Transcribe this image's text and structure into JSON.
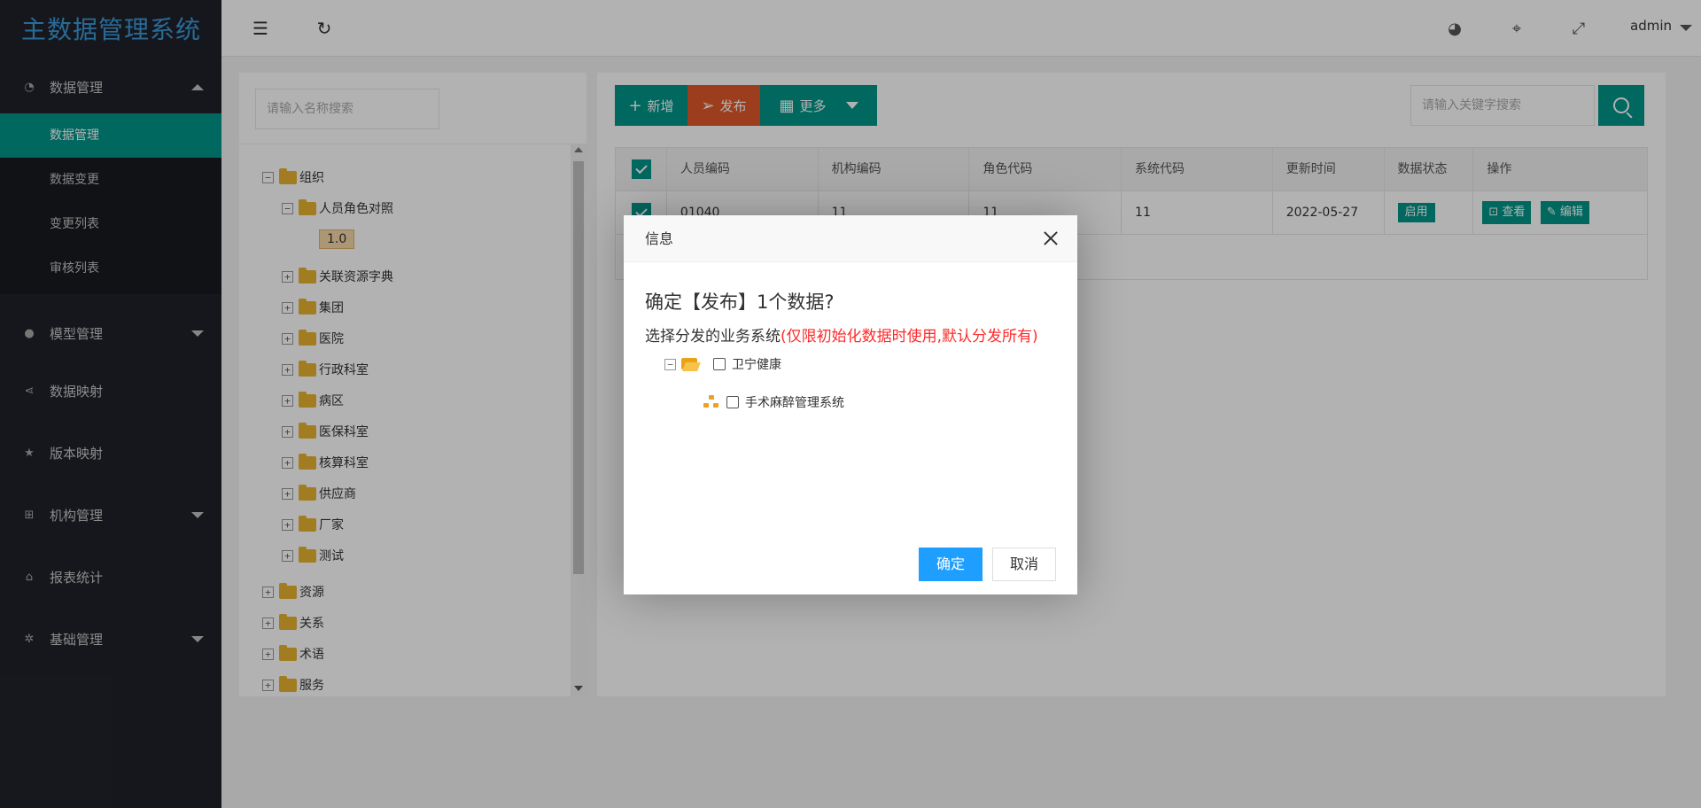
{
  "app": {
    "title": "主数据管理系统"
  },
  "sidebar": {
    "groups": [
      {
        "label": "数据管理",
        "icon": "dashboard-icon",
        "expanded": true,
        "items": [
          {
            "label": "数据管理",
            "active": true
          },
          {
            "label": "数据变更"
          },
          {
            "label": "变更列表"
          },
          {
            "label": "审核列表"
          }
        ]
      },
      {
        "label": "模型管理",
        "icon": "circle-icon",
        "expanded": false
      },
      {
        "label": "数据映射",
        "icon": "share-icon"
      },
      {
        "label": "版本映射",
        "icon": "star-icon"
      },
      {
        "label": "机构管理",
        "icon": "org-icon",
        "expanded": false
      },
      {
        "label": "报表统计",
        "icon": "home-icon"
      },
      {
        "label": "基础管理",
        "icon": "gear-icon",
        "expanded": false
      }
    ]
  },
  "topbar": {
    "icons": [
      "menu-fold-icon",
      "refresh-icon",
      "palette-icon",
      "tag-icon",
      "fullscreen-icon"
    ],
    "user": "admin"
  },
  "tree": {
    "search_placeholder": "请输入名称搜索",
    "nodes": {
      "org": "组织",
      "role_map": "人员角色对照",
      "version": "1.0",
      "res_dict": "关联资源字典",
      "group": "集团",
      "hospital": "医院",
      "admin_dept": "行政科室",
      "ward": "病区",
      "insurance_dept": "医保科室",
      "accounting_dept": "核算科室",
      "supplier": "供应商",
      "factory": "厂家",
      "test": "测试",
      "resource": "资源",
      "relation": "关系",
      "term": "术语",
      "service": "服务"
    }
  },
  "toolbar": {
    "add_label": "新增",
    "publish_label": "发布",
    "more_label": "更多",
    "search_placeholder": "请输入关键字搜索"
  },
  "grid": {
    "columns": [
      "人员编码",
      "机构编码",
      "角色代码",
      "系统代码",
      "更新时间",
      "数据状态",
      "操作"
    ],
    "rows": [
      {
        "person_code": "01040",
        "org_code": "11",
        "role_code": "11",
        "system_code": "11",
        "updated": "2022-05-27",
        "status": "启用",
        "view_label": "查看",
        "edit_label": "编辑"
      }
    ]
  },
  "dialog": {
    "title": "信息",
    "question": "确定【发布】1个数据?",
    "subtitle": "选择分发的业务系统",
    "subtitle_note": "(仅限初始化数据时使用,默认分发所有)",
    "tree": {
      "root": "卫宁健康",
      "child": "手术麻醉管理系统"
    },
    "confirm_label": "确定",
    "cancel_label": "取消"
  },
  "colors": {
    "sidebar_bg": "#20222a",
    "primary": "#009688",
    "publish": "#e05a2a",
    "dialog_primary": "#1e9fff",
    "warning_text": "#ff2a2a"
  }
}
